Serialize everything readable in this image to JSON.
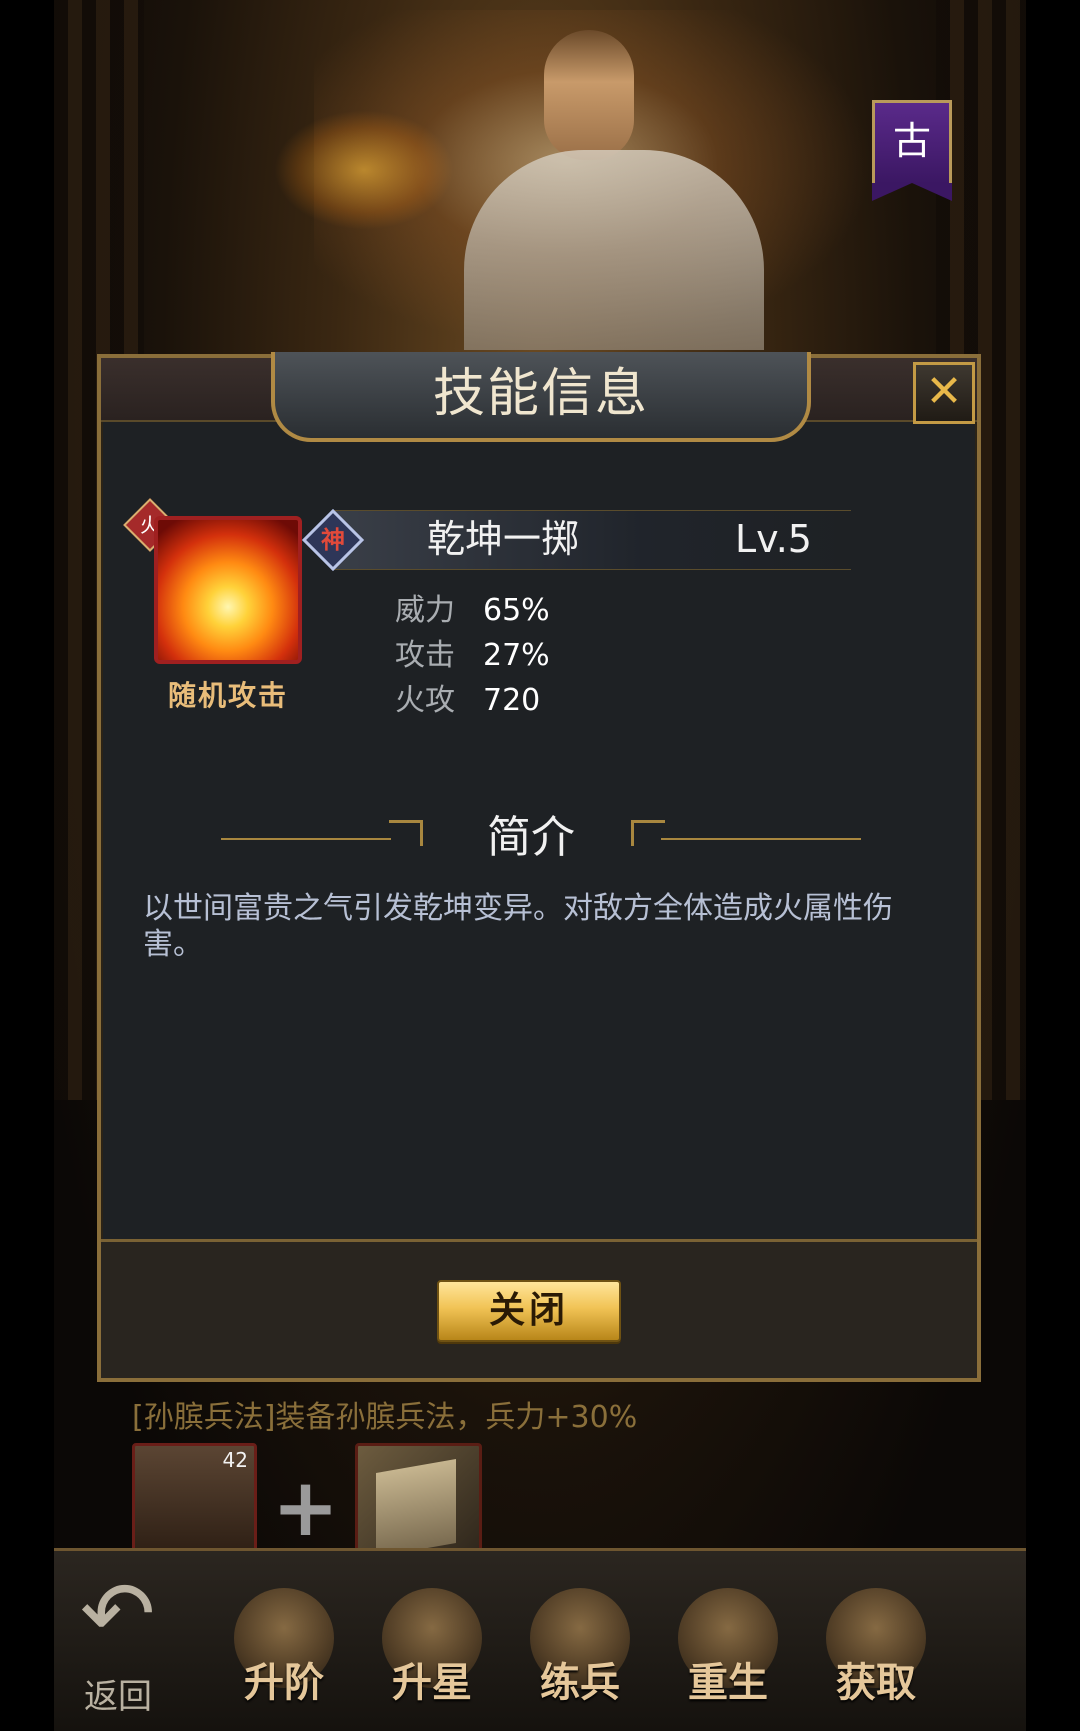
{
  "background": {
    "hero_banner_text": "古",
    "equip_hint": "[孙膑兵法]装备孙膑兵法，兵力+30%",
    "portrait_level": "42",
    "plus_symbol": "+"
  },
  "dialog": {
    "title": "技能信息",
    "close_icon_glyph": "✕",
    "skill": {
      "element_glyph": "火",
      "type_label": "随机攻击",
      "tier_glyph": "神",
      "name": "乾坤一掷",
      "level": "Lv.5",
      "stats": [
        {
          "label": "威力",
          "value": "65%"
        },
        {
          "label": "攻击",
          "value": "27%"
        },
        {
          "label": "火攻",
          "value": "720"
        }
      ]
    },
    "intro": {
      "heading": "简介",
      "text": "以世间富贵之气引发乾坤变异。对敌方全体造成火属性伤害。"
    },
    "close_button_label": "关闭"
  },
  "bottom_nav": {
    "back_label": "返回",
    "back_glyph": "↶",
    "items": [
      {
        "label": "升阶",
        "icon": "advance-icon"
      },
      {
        "label": "升星",
        "icon": "star-up-icon"
      },
      {
        "label": "练兵",
        "icon": "train-icon"
      },
      {
        "label": "重生",
        "icon": "rebirth-icon"
      },
      {
        "label": "获取",
        "icon": "obtain-icon"
      }
    ]
  },
  "colors": {
    "dialog_bg": "#1e2124",
    "gold_border": "#8a6e3a",
    "title_text": "#f0e6cf",
    "stat_label": "#a9adb1",
    "intro_text": "#b7c0d4",
    "button_gold": "#f1c355"
  }
}
